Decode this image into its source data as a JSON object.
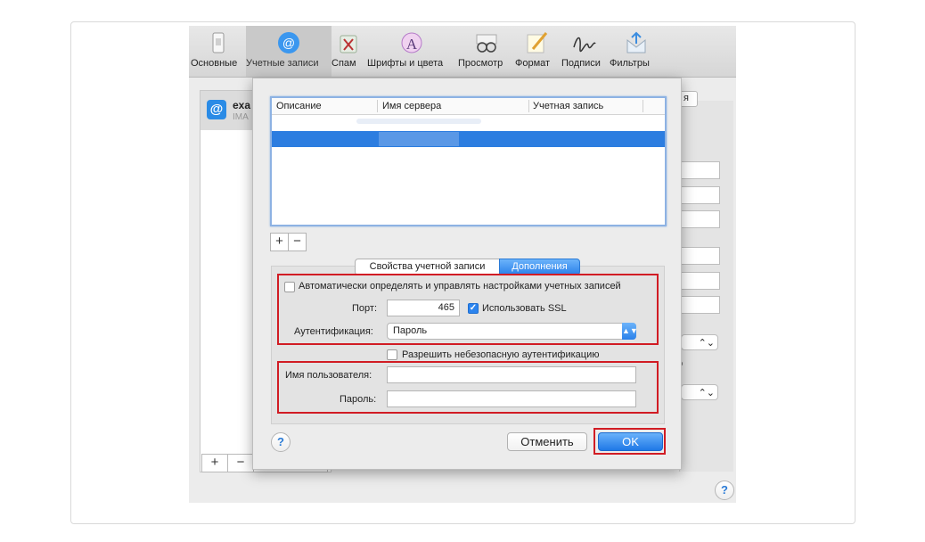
{
  "toolbar": {
    "items": [
      {
        "label": "Основные",
        "icon": "switch-icon"
      },
      {
        "label": "Учетные записи",
        "icon": "at-icon"
      },
      {
        "label": "Спам",
        "icon": "trash-icon"
      },
      {
        "label": "Шрифты и цвета",
        "icon": "font-icon"
      },
      {
        "label": "Просмотр",
        "icon": "glasses-icon"
      },
      {
        "label": "Формат",
        "icon": "pencil-icon"
      },
      {
        "label": "Подписи",
        "icon": "signature-icon"
      },
      {
        "label": "Фильтры",
        "icon": "filter-icon"
      }
    ]
  },
  "sidebar": {
    "account_name": "exa",
    "account_type": "IMA"
  },
  "background": {
    "tab_fragment": "я",
    "dropdown_fragment": "о"
  },
  "accounts_table": {
    "columns": [
      "Описание",
      "Имя сервера",
      "Учетная запись"
    ]
  },
  "tabs": {
    "account_properties": "Свойства учетной записи",
    "advanced": "Дополнения"
  },
  "advanced": {
    "auto_manage_label": "Автоматически определять и управлять настройками учетных записей",
    "auto_manage_checked": false,
    "port_label": "Порт:",
    "port_value": "465",
    "use_ssl_label": "Использовать SSL",
    "use_ssl_checked": true,
    "auth_label": "Аутентификация:",
    "auth_value": "Пароль",
    "allow_insecure_label": "Разрешить небезопасную аутентификацию",
    "allow_insecure_checked": false,
    "username_label": "Имя пользователя:",
    "username_value": "",
    "password_label": "Пароль:",
    "password_value": ""
  },
  "buttons": {
    "add": "+",
    "remove": "−",
    "help": "?",
    "cancel": "Отменить",
    "ok": "OK"
  },
  "colors": {
    "accent": "#2c7de0",
    "highlight_box": "#d11c24"
  }
}
